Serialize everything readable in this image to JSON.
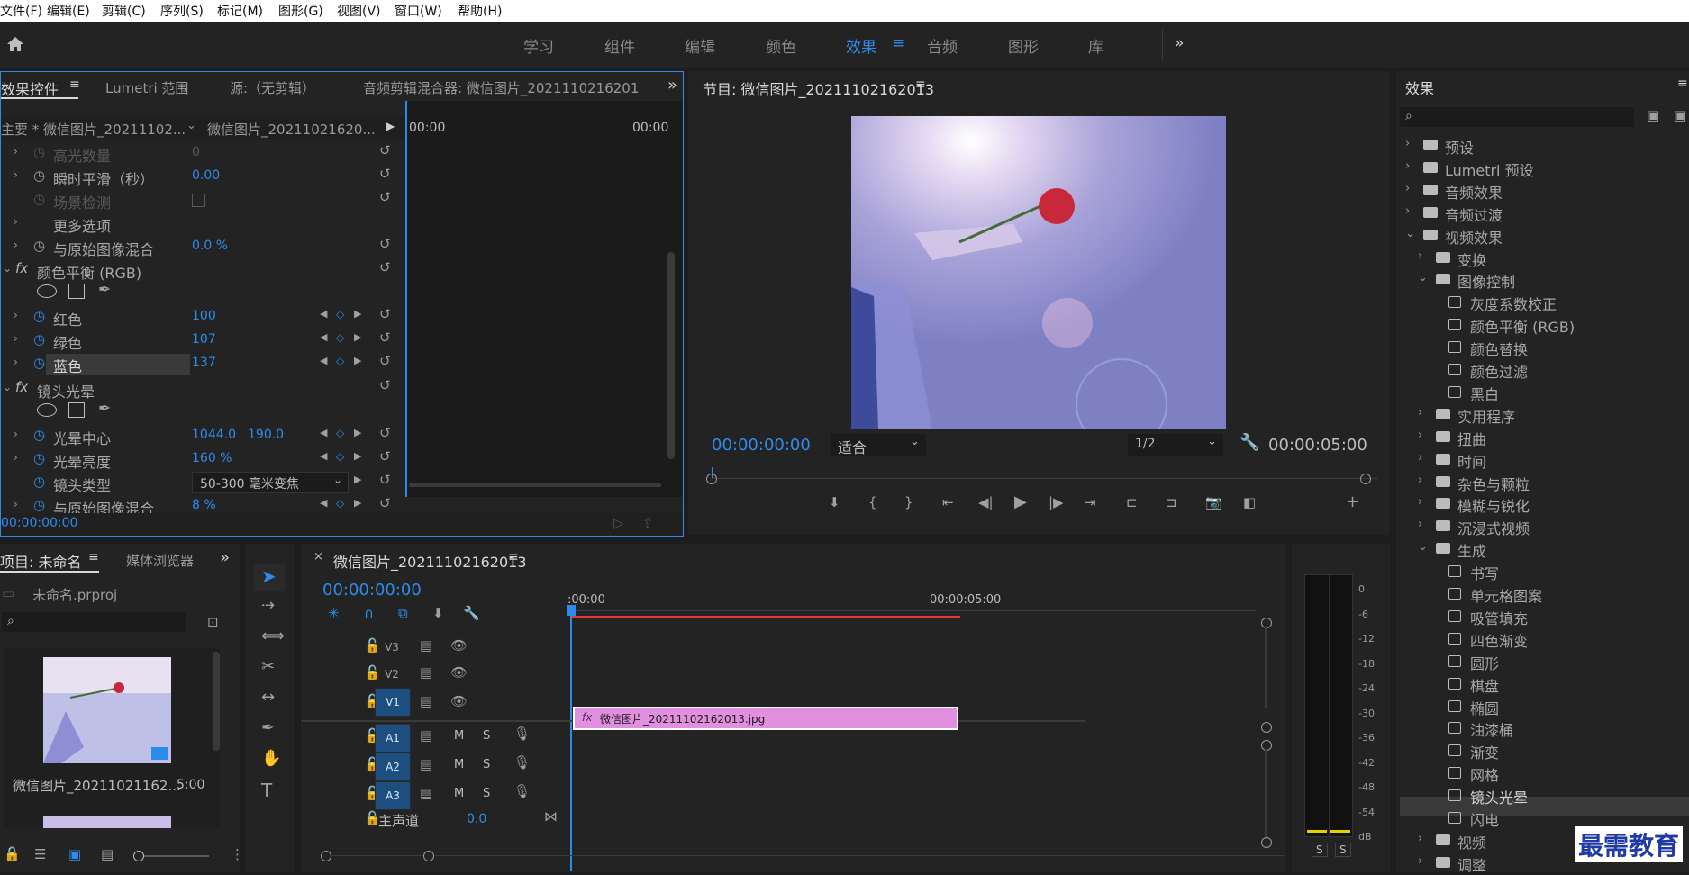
{
  "menu": [
    "文件(F)",
    "编辑(E)",
    "剪辑(C)",
    "序列(S)",
    "标记(M)",
    "图形(G)",
    "视图(V)",
    "窗口(W)",
    "帮助(H)"
  ],
  "workspaces": [
    "学习",
    "组件",
    "编辑",
    "颜色",
    "效果",
    "音频",
    "图形",
    "库"
  ],
  "active_workspace": "效果",
  "effect_controls": {
    "tabs": [
      "效果控件",
      "Lumetri 范围",
      "源:（无剪辑）",
      "音频剪辑混合器: 微信图片_2021110216201"
    ],
    "master_label": "主要 * 微信图片_20211102...",
    "clip_label": "微信图片_20211021620...",
    "time_start": "00:00",
    "time_end": "00:00",
    "rows": [
      {
        "label": "高光数量",
        "value": "0",
        "dim": true
      },
      {
        "label": "瞬时平滑（秒）",
        "value": "0.00"
      },
      {
        "label": "场景检测",
        "value": ""
      },
      {
        "label": "更多选项",
        "value": ""
      },
      {
        "label": "与原始图像混合",
        "value": "0.0 %"
      }
    ],
    "fx1_name": "颜色平衡 (RGB)",
    "fx1_rows": [
      {
        "label": "红色",
        "value": "100"
      },
      {
        "label": "绿色",
        "value": "107"
      },
      {
        "label": "蓝色",
        "value": "137"
      }
    ],
    "fx2_name": "镜头光晕",
    "fx2_rows": [
      {
        "label": "光晕中心",
        "value": "1044.0",
        "value2": "190.0"
      },
      {
        "label": "光晕亮度",
        "value": "160 %"
      },
      {
        "label": "镜头类型",
        "value": "50-300 毫米变焦"
      },
      {
        "label": "与原始图像混合",
        "value": "8 %"
      }
    ],
    "bottom_time": "00:00:00:00"
  },
  "program": {
    "title": "节目: 微信图片_20211102162013",
    "timecode": "00:00:00:00",
    "fit": "适合",
    "resolution": "1/2",
    "duration": "00:00:05:00"
  },
  "effects_panel": {
    "title": "效果",
    "items": [
      {
        "label": "预设",
        "level": 0,
        "type": "folder-star",
        "open": false
      },
      {
        "label": "Lumetri 预设",
        "level": 0,
        "type": "folder-star",
        "open": false
      },
      {
        "label": "音频效果",
        "level": 0,
        "type": "folder",
        "open": false
      },
      {
        "label": "音频过渡",
        "level": 0,
        "type": "folder",
        "open": false
      },
      {
        "label": "视频效果",
        "level": 0,
        "type": "folder",
        "open": true
      },
      {
        "label": "变换",
        "level": 1,
        "type": "folder",
        "open": false
      },
      {
        "label": "图像控制",
        "level": 1,
        "type": "folder",
        "open": true
      },
      {
        "label": "灰度系数校正",
        "level": 2,
        "type": "fx"
      },
      {
        "label": "颜色平衡 (RGB)",
        "level": 2,
        "type": "fx"
      },
      {
        "label": "颜色替换",
        "level": 2,
        "type": "fx"
      },
      {
        "label": "颜色过滤",
        "level": 2,
        "type": "fx"
      },
      {
        "label": "黑白",
        "level": 2,
        "type": "fx"
      },
      {
        "label": "实用程序",
        "level": 1,
        "type": "folder",
        "open": false
      },
      {
        "label": "扭曲",
        "level": 1,
        "type": "folder",
        "open": false
      },
      {
        "label": "时间",
        "level": 1,
        "type": "folder",
        "open": false
      },
      {
        "label": "杂色与颗粒",
        "level": 1,
        "type": "folder",
        "open": false
      },
      {
        "label": "模糊与锐化",
        "level": 1,
        "type": "folder",
        "open": false
      },
      {
        "label": "沉浸式视频",
        "level": 1,
        "type": "folder",
        "open": false
      },
      {
        "label": "生成",
        "level": 1,
        "type": "folder",
        "open": true
      },
      {
        "label": "书写",
        "level": 2,
        "type": "fx"
      },
      {
        "label": "单元格图案",
        "level": 2,
        "type": "fx"
      },
      {
        "label": "吸管填充",
        "level": 2,
        "type": "fx"
      },
      {
        "label": "四色渐变",
        "level": 2,
        "type": "fx"
      },
      {
        "label": "圆形",
        "level": 2,
        "type": "fx"
      },
      {
        "label": "棋盘",
        "level": 2,
        "type": "fx"
      },
      {
        "label": "椭圆",
        "level": 2,
        "type": "fx"
      },
      {
        "label": "油漆桶",
        "level": 2,
        "type": "fx"
      },
      {
        "label": "渐变",
        "level": 2,
        "type": "fx"
      },
      {
        "label": "网格",
        "level": 2,
        "type": "fx"
      },
      {
        "label": "镜头光晕",
        "level": 2,
        "type": "fx",
        "selected": true
      },
      {
        "label": "闪电",
        "level": 2,
        "type": "fx"
      },
      {
        "label": "视频",
        "level": 1,
        "type": "folder",
        "open": false
      },
      {
        "label": "调整",
        "level": 1,
        "type": "folder",
        "open": false
      }
    ]
  },
  "project": {
    "tab1": "项目: 未命名",
    "tab2": "媒体浏览器",
    "file": "未命名.prproj",
    "clip_name": "微信图片_20211021162...",
    "clip_duration": "5:00"
  },
  "timeline": {
    "tab": "微信图片_20211102162013",
    "timecode": "00:00:00:00",
    "ruler_start": ":00:00",
    "ruler_mid": "00:00:05:00",
    "tracks_video": [
      "V3",
      "V2",
      "V1"
    ],
    "tracks_audio": [
      "A1",
      "A2",
      "A3"
    ],
    "master": "主声道",
    "master_value": "0.0",
    "clip_label": "微信图片_20211102162013.jpg",
    "clip_fx": "fx",
    "track_m": "M",
    "track_s": "S"
  },
  "meter": {
    "scale": [
      "0",
      "-6",
      "-12",
      "-18",
      "-24",
      "-30",
      "-36",
      "-42",
      "-48",
      "-54",
      "dB"
    ],
    "solo_left": "S",
    "solo_right": "S"
  },
  "watermark": "最需教育"
}
